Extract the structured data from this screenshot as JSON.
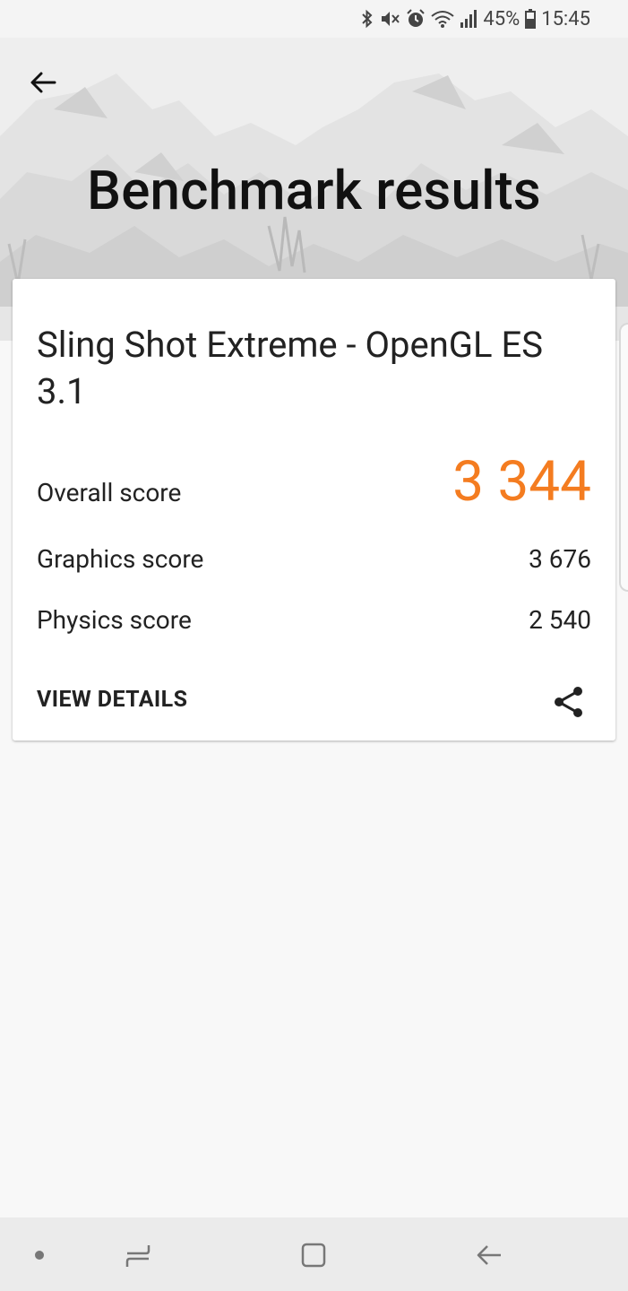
{
  "status_bar": {
    "battery_percent": "45%",
    "time": "15:45",
    "icons": [
      "bluetooth-icon",
      "mute-icon",
      "alarm-icon",
      "wifi-icon",
      "signal-icon",
      "battery-icon"
    ]
  },
  "header": {
    "title": "Benchmark results",
    "back_icon": "arrow-left-icon"
  },
  "result_card": {
    "test_name": "Sling Shot Extreme - OpenGL ES 3.1",
    "overall_label": "Overall score",
    "overall_value": "3 344",
    "graphics_label": "Graphics score",
    "graphics_value": "3 676",
    "physics_label": "Physics score",
    "physics_value": "2 540",
    "view_details_label": "VIEW DETAILS",
    "share_icon": "share-icon"
  },
  "nav_bar": {
    "items": [
      "dot-icon",
      "recents-icon",
      "home-icon",
      "back-icon"
    ]
  },
  "colors": {
    "accent_orange": "#f47c20",
    "background": "#f8f8f8",
    "card": "#ffffff"
  }
}
